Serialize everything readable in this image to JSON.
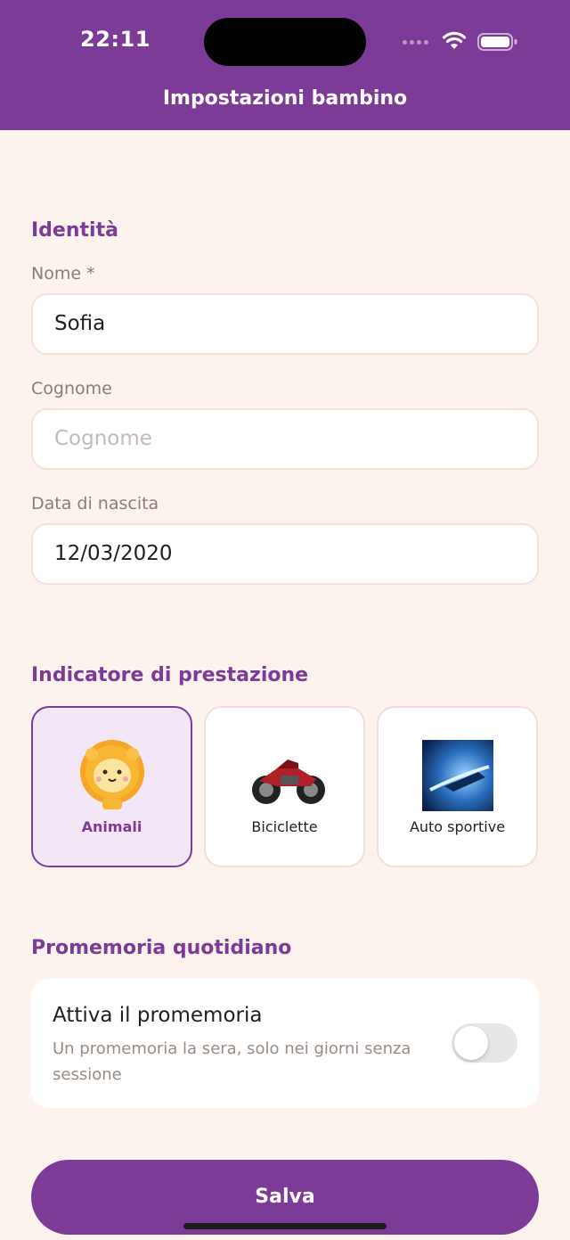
{
  "status_bar": {
    "time": "22:11",
    "icons": [
      "cellular-signal-icon",
      "wifi-icon",
      "battery-icon"
    ]
  },
  "header": {
    "title": "Impostazioni bambino"
  },
  "identity": {
    "section_title": "Identità",
    "name": {
      "label": "Nome *",
      "value": "Sofia"
    },
    "surname": {
      "label": "Cognome",
      "placeholder": "Cognome",
      "value": ""
    },
    "birthdate": {
      "label": "Data di nascita",
      "value": "12/03/2020"
    }
  },
  "indicator": {
    "section_title": "Indicatore di prestazione",
    "options": [
      {
        "label": "Animali",
        "icon": "lion-icon",
        "selected": true
      },
      {
        "label": "Biciclette",
        "icon": "motorbike-icon",
        "selected": false
      },
      {
        "label": "Auto sportive",
        "icon": "sports-car-icon",
        "selected": false
      }
    ]
  },
  "reminder": {
    "section_title": "Promemoria quotidiano",
    "title": "Attiva il promemoria",
    "description": "Un promemoria la sera, solo nei giorni senza sessione",
    "enabled": false
  },
  "save_button": {
    "label": "Salva"
  },
  "colors": {
    "primary": "#7c3b97",
    "background": "#fdf3ee",
    "selected_card": "#f3e6f7",
    "toggle_off": "#e6e6e9"
  }
}
